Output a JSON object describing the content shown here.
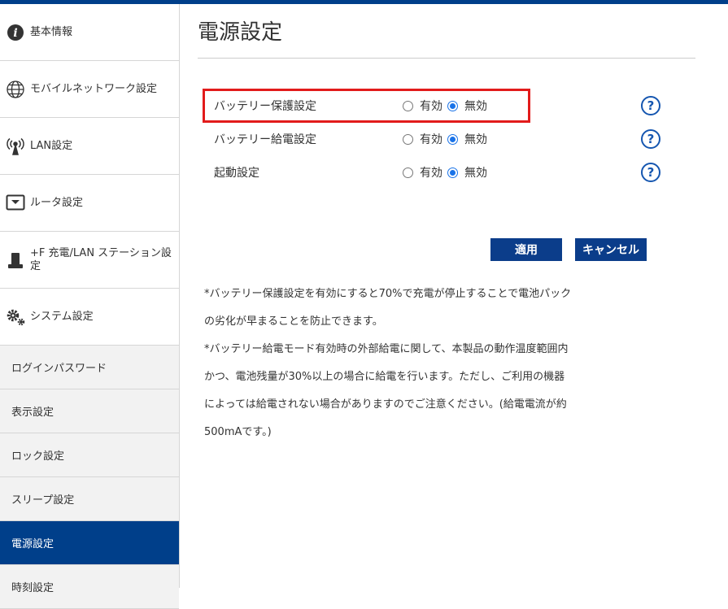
{
  "sidebar": {
    "items": [
      {
        "label": "基本情報",
        "icon": "info-icon"
      },
      {
        "label": "モバイルネットワーク設定",
        "icon": "globe-icon"
      },
      {
        "label": "LAN設定",
        "icon": "antenna-icon"
      },
      {
        "label": "ルータ設定",
        "icon": "router-icon"
      },
      {
        "label": "+F 充電/LAN ステーション設定",
        "icon": "station-icon"
      },
      {
        "label": "システム設定",
        "icon": "gears-icon"
      }
    ],
    "sub_items": [
      {
        "label": "ログインパスワード"
      },
      {
        "label": "表示設定"
      },
      {
        "label": "ロック設定"
      },
      {
        "label": "スリープ設定"
      },
      {
        "label": "電源設定",
        "active": true
      },
      {
        "label": "時刻設定"
      }
    ]
  },
  "main": {
    "title": "電源設定",
    "settings": [
      {
        "label": "バッテリー保護設定",
        "enabled_label": "有効",
        "disabled_label": "無効",
        "selected": "無効"
      },
      {
        "label": "バッテリー給電設定",
        "enabled_label": "有効",
        "disabled_label": "無効",
        "selected": "無効"
      },
      {
        "label": "起動設定",
        "enabled_label": "有効",
        "disabled_label": "無効",
        "selected": "無効"
      }
    ],
    "help_glyph": "?",
    "apply_label": "適用",
    "cancel_label": "キャンセル",
    "notes": [
      "*バッテリー保護設定を有効にすると70%で充電が停止することで電池パック",
      "の劣化が早まることを防止できます。",
      "*バッテリー給電モード有効時の外部給電に関して、本製品の動作温度範囲内",
      "かつ、電池残量が30%以上の場合に給電を行います。ただし、ご利用の機器",
      "によっては給電されない場合がありますのでご注意ください。(給電電流が約",
      "500mAです。)"
    ]
  },
  "colors": {
    "accent": "#003f8a",
    "highlight": "#e21b1b",
    "radio": "#1a73e8",
    "help": "#1556b0"
  }
}
